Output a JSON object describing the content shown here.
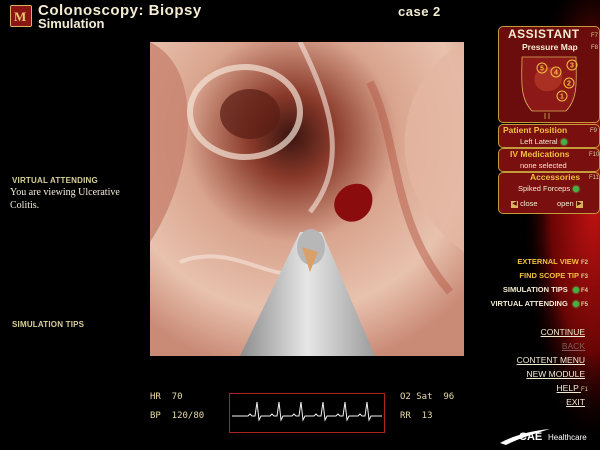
{
  "header": {
    "title": "Colonoscopy: Biopsy",
    "subtitle": "Simulation",
    "case": "case 2"
  },
  "left_panel": {
    "virtual_attending_title": "VIRTUAL ATTENDING",
    "virtual_attending_text": "You are viewing Ulcerative Colitis.",
    "simulation_tips_title": "SIMULATION TIPS"
  },
  "vitals": {
    "hr": "HR  70",
    "bp": "BP  120/80",
    "o2": "O2 Sat  96",
    "rr": "RR  13"
  },
  "assistant": {
    "title": "ASSISTANT",
    "title_key": "F7",
    "pressure_map": "Pressure Map",
    "pressure_map_key": "F8",
    "pressure_points": [
      "1",
      "2",
      "3",
      "4",
      "5"
    ],
    "patient_position_title": "Patient Position",
    "patient_position_key": "F9",
    "patient_position_value": "Left Lateral",
    "iv_title": "IV Medications",
    "iv_key": "F10",
    "iv_value": "none selected",
    "accessories_title": "Accessories",
    "accessories_key": "F11",
    "accessories_value": "Spiked Forceps",
    "close_label": "close",
    "open_label": "open"
  },
  "menu": {
    "external_view": "EXTERNAL VIEW",
    "external_view_key": "F2",
    "find_scope_tip": "FIND SCOPE TIP",
    "find_scope_tip_key": "F3",
    "simulation_tips": "SIMULATION TIPS",
    "simulation_tips_key": "F4",
    "virtual_attending": "VIRTUAL ATTENDING",
    "virtual_attending_key": "F5"
  },
  "nav": {
    "continue": "CONTINUE",
    "back": "BACK",
    "content_menu": "CONTENT MENU",
    "new_module": "NEW MODULE",
    "help": "HELP",
    "help_key": "F1",
    "exit": "EXIT"
  },
  "brand": {
    "logo_text": "CAE",
    "logo_sub": "Healthcare"
  },
  "colors": {
    "accent": "#f0c040",
    "panel": "#7a0f0f",
    "ecg_border": "#b0201c"
  }
}
